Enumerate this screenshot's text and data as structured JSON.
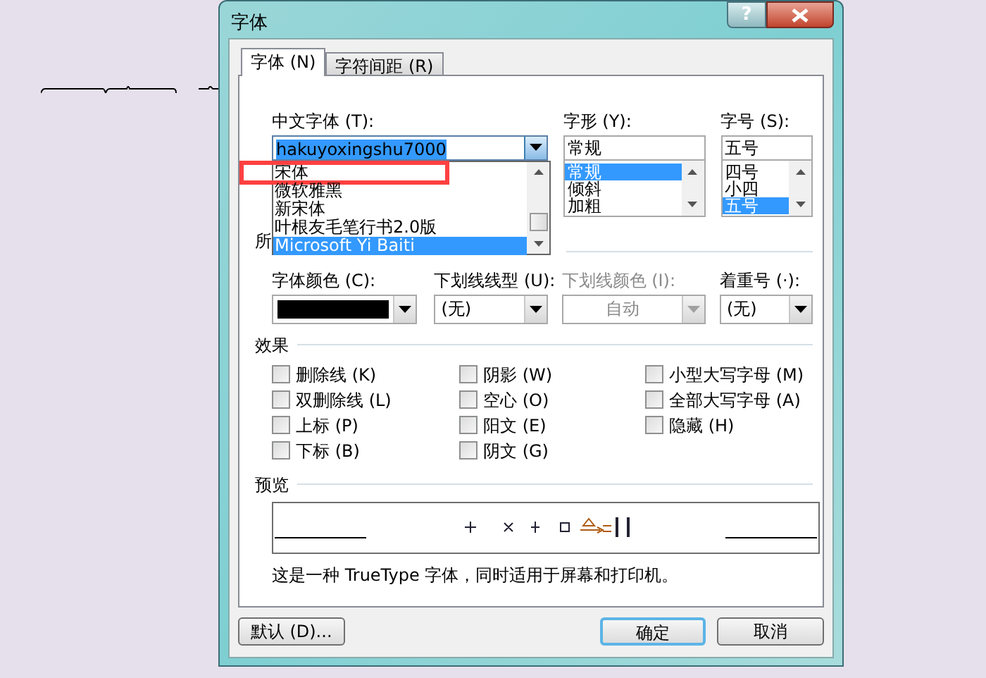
{
  "window": {
    "title": "字体",
    "help_button": "?"
  },
  "tabs": [
    {
      "label": "字体 (N)",
      "selected": true
    },
    {
      "label": "字符间距 (R)",
      "selected": false
    }
  ],
  "chinese_font": {
    "label": "中文字体 (T):",
    "value": "hakuyoxingshu7000",
    "dropdown": [
      {
        "label": "宋体",
        "selected": false,
        "highlighted": true
      },
      {
        "label": "微软雅黑",
        "selected": false,
        "highlighted": false
      },
      {
        "label": "新宋体",
        "selected": false,
        "highlighted": false
      },
      {
        "label": "叶根友毛笔行书2.0版",
        "selected": false,
        "highlighted": false
      },
      {
        "label": "Microsoft Yi Baiti",
        "selected": true,
        "highlighted": false
      }
    ]
  },
  "font_style": {
    "label": "字形 (Y):",
    "value": "常规",
    "options": [
      {
        "label": "常规",
        "selected": true
      },
      {
        "label": "倾斜",
        "selected": false
      },
      {
        "label": "加粗",
        "selected": false
      }
    ]
  },
  "font_size": {
    "label": "字号 (S):",
    "value": "五号",
    "options": [
      {
        "label": "四号",
        "selected": false
      },
      {
        "label": "小四",
        "selected": false
      },
      {
        "label": "五号",
        "selected": true
      }
    ]
  },
  "covered_label": "所",
  "font_color": {
    "label": "字体颜色 (C):",
    "color": "#000000"
  },
  "underline_style": {
    "label": "下划线线型 (U):",
    "value": "(无)"
  },
  "underline_color": {
    "label": "下划线颜色 (I):",
    "value": "自动",
    "disabled": true
  },
  "emphasis_mark": {
    "label": "着重号 (·):",
    "value": "(无)"
  },
  "effects": {
    "heading": "效果",
    "columns": [
      [
        {
          "label": "删除线 (K)",
          "checked": false
        },
        {
          "label": "双删除线 (L)",
          "checked": false
        },
        {
          "label": "上标 (P)",
          "checked": false
        },
        {
          "label": "下标 (B)",
          "checked": false
        }
      ],
      [
        {
          "label": "阴影 (W)",
          "checked": false
        },
        {
          "label": "空心 (O)",
          "checked": false
        },
        {
          "label": "阳文 (E)",
          "checked": false
        },
        {
          "label": "阴文 (G)",
          "checked": false
        }
      ],
      [
        {
          "label": "小型大写字母 (M)",
          "checked": false
        },
        {
          "label": "全部大写字母 (A)",
          "checked": false
        },
        {
          "label": "隐藏 (H)",
          "checked": false
        }
      ]
    ]
  },
  "preview": {
    "heading": "预览",
    "description": "这是一种 TrueType 字体，同时适用于屏幕和打印机。"
  },
  "buttons": [
    {
      "label": "默认 (D)...",
      "default": false
    },
    {
      "label": "确定",
      "default": true
    },
    {
      "label": "取消",
      "default": false
    }
  ]
}
